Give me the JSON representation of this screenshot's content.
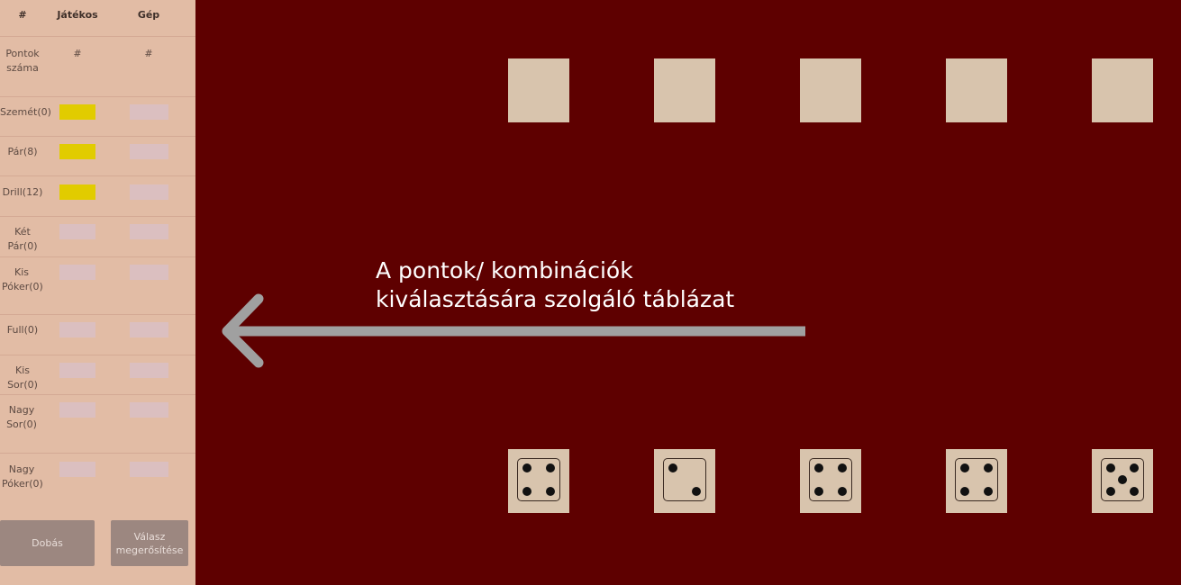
{
  "table": {
    "header": {
      "col_index": "#",
      "col_player": "Játékos",
      "col_cpu": "Gép"
    },
    "points_row": {
      "label": "Pontok száma",
      "player": "#",
      "cpu": "#"
    },
    "rows": [
      {
        "label": "Szemét(0)",
        "player_selected": true
      },
      {
        "label": "Pár(8)",
        "player_selected": true
      },
      {
        "label": "Drill(12)",
        "player_selected": true
      },
      {
        "label": "Két Pár(0)",
        "player_selected": false
      },
      {
        "label": "Kis Póker(0)",
        "player_selected": false
      },
      {
        "label": "Full(0)",
        "player_selected": false
      },
      {
        "label": "Kis Sor(0)",
        "player_selected": false
      },
      {
        "label": "Nagy Sor(0)",
        "player_selected": false
      },
      {
        "label": "Nagy Póker(0)",
        "player_selected": false
      }
    ]
  },
  "buttons": {
    "roll": "Dobás",
    "confirm": "Válasz megerősítése"
  },
  "annotation": {
    "line1": "A pontok/ kombinációk",
    "line2": "kiválasztására szolgáló táblázat"
  },
  "dice": {
    "top_row_values": [
      null,
      null,
      null,
      null,
      null
    ],
    "bottom_row_values": [
      4,
      2,
      4,
      4,
      5
    ]
  },
  "colors": {
    "background": "#5e0000",
    "panel": "#e2bca5",
    "selected_cell": "#e1cc00",
    "empty_cell": "#dbbfc0",
    "button": "#9c8780",
    "die": "#d8c4ad",
    "arrow": "#a0a0a0"
  }
}
